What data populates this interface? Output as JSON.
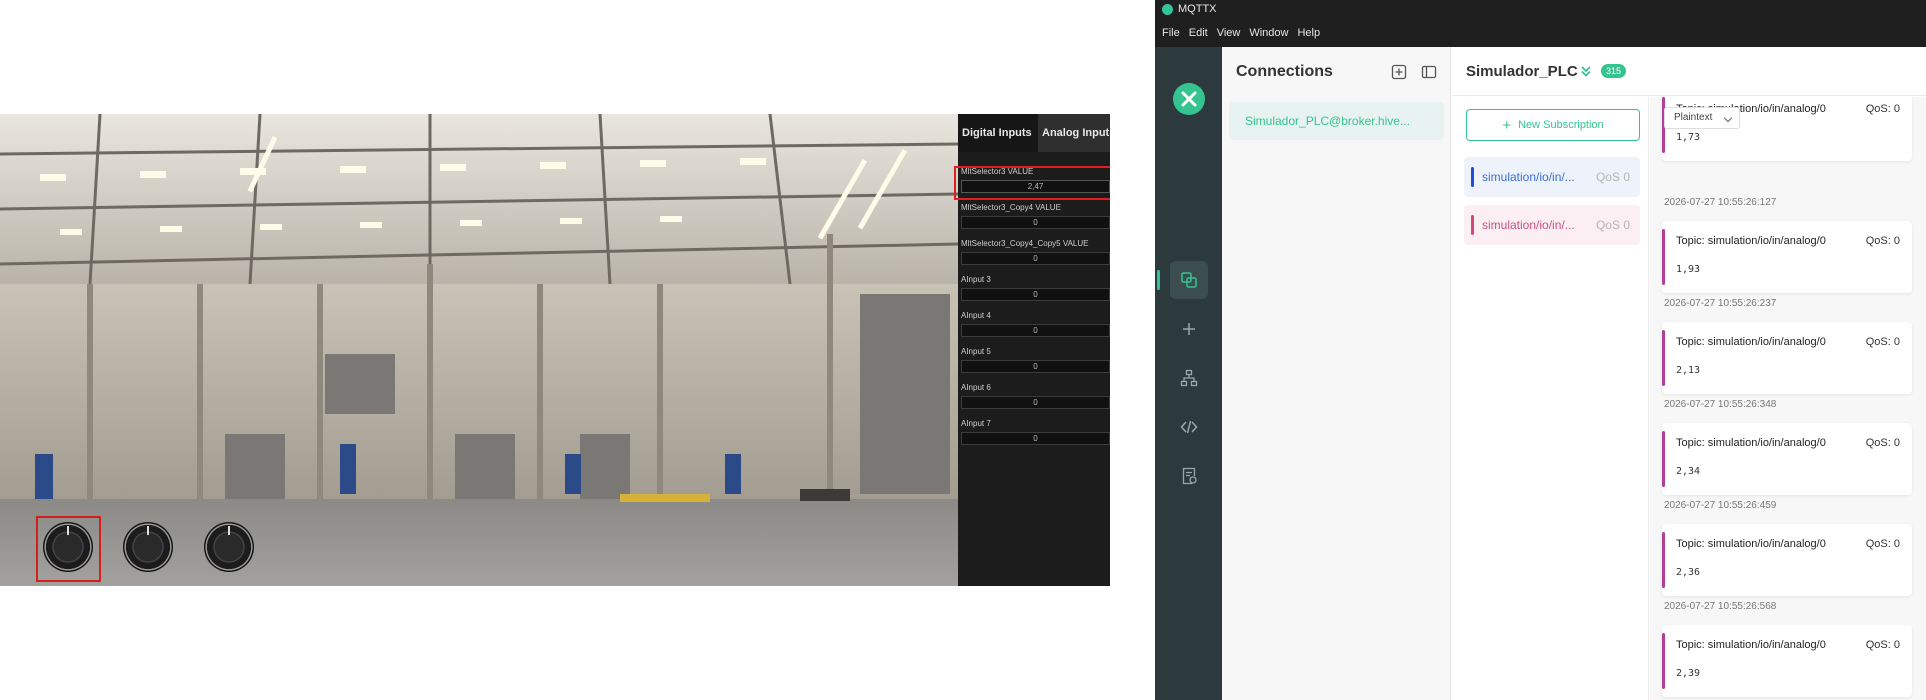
{
  "simulator": {
    "tabs": {
      "digital": "Digital Inputs",
      "analog": "Analog Inputs"
    },
    "analog_inputs": [
      {
        "label": "MltSelector3 VALUE",
        "value": "2,47"
      },
      {
        "label": "MltSelector3_Copy4 VALUE",
        "value": "0"
      },
      {
        "label": "MltSelector3_Copy4_Copy5 VALUE",
        "value": "0"
      },
      {
        "label": "AInput 3",
        "value": "0"
      },
      {
        "label": "AInput 4",
        "value": "0"
      },
      {
        "label": "AInput 5",
        "value": "0"
      },
      {
        "label": "AInput 6",
        "value": "0"
      },
      {
        "label": "AInput 7",
        "value": "0"
      }
    ],
    "knob_count": 3,
    "selected_knob": 1
  },
  "window": {
    "title": "MQTTX",
    "menu": [
      "File",
      "Edit",
      "View",
      "Window",
      "Help"
    ]
  },
  "sidebar": {
    "icons": [
      "connections-icon",
      "new-connection-icon",
      "topology-icon",
      "script-icon",
      "log-icon"
    ],
    "active": "connections-icon"
  },
  "connections": {
    "title": "Connections",
    "items": [
      {
        "label": "Simulador_PLC@broker.hive..."
      }
    ]
  },
  "main": {
    "connection_name": "Simulador_PLC",
    "message_count": "315",
    "new_subscription": "New Subscription",
    "format": "Plaintext",
    "subscriptions": [
      {
        "topic": "simulation/io/in/...",
        "qos": "QoS 0",
        "color": "#1e4ed8"
      },
      {
        "topic": "simulation/io/in/...",
        "qos": "QoS 0",
        "color": "#d0487e"
      }
    ],
    "messages": [
      {
        "topic": "Topic: simulation/io/in/analog/0",
        "qos": "QoS: 0",
        "payload": "1,73",
        "time": "2026-07-27 10:55:26:127"
      },
      {
        "topic": "Topic: simulation/io/in/analog/0",
        "qos": "QoS: 0",
        "payload": "1,93",
        "time": "2026-07-27 10:55:26:237"
      },
      {
        "topic": "Topic: simulation/io/in/analog/0",
        "qos": "QoS: 0",
        "payload": "2,13",
        "time": "2026-07-27 10:55:26:348"
      },
      {
        "topic": "Topic: simulation/io/in/analog/0",
        "qos": "QoS: 0",
        "payload": "2,34",
        "time": "2026-07-27 10:55:26:459"
      },
      {
        "topic": "Topic: simulation/io/in/analog/0",
        "qos": "QoS: 0",
        "payload": "2,36",
        "time": "2026-07-27 10:55:26:568"
      },
      {
        "topic": "Topic: simulation/io/in/analog/0",
        "qos": "QoS: 0",
        "payload": "2,39",
        "time": ""
      }
    ],
    "accent_color": "#35c38f"
  }
}
